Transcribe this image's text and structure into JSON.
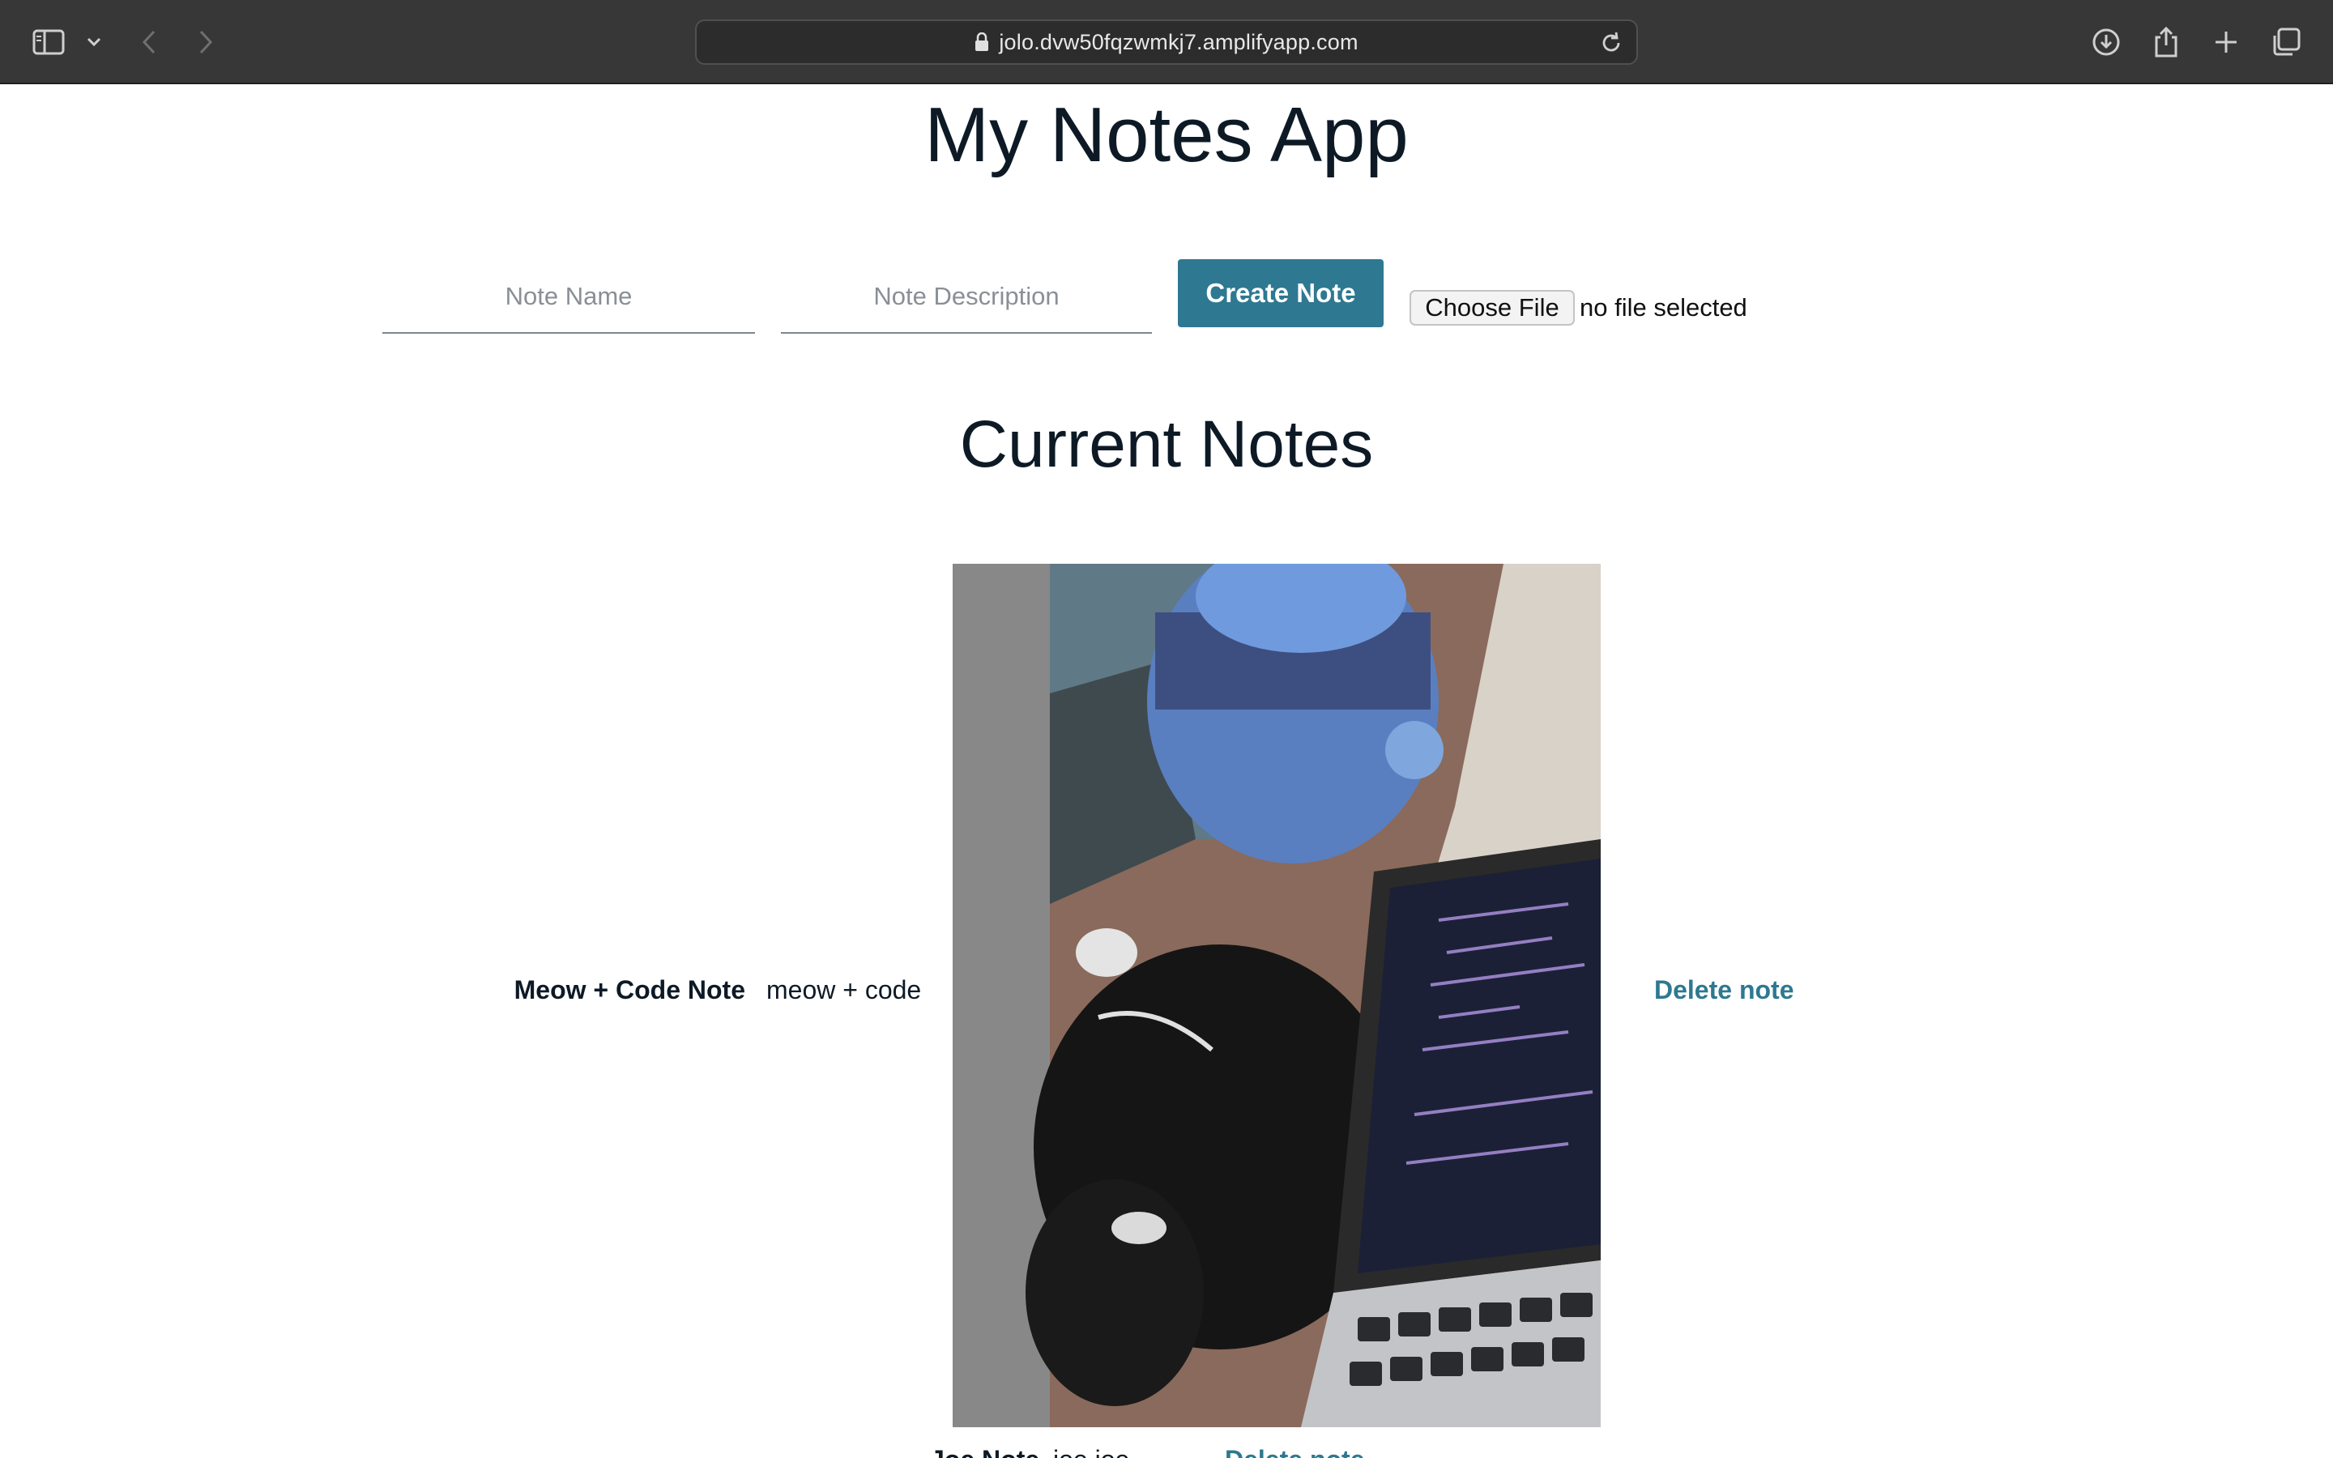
{
  "browser": {
    "url": "jolo.dvw50fqzwmkj7.amplifyapp.com"
  },
  "app": {
    "title": "My Notes App"
  },
  "form": {
    "name_placeholder": "Note Name",
    "description_placeholder": "Note Description",
    "create_label": "Create Note",
    "file_button_label": "Choose File",
    "file_status": "no file selected"
  },
  "section": {
    "title": "Current Notes"
  },
  "notes": [
    {
      "name": "Meow + Code Note",
      "description": "meow + code",
      "delete_label": "Delete note",
      "image": "cat-laptop-photo"
    },
    {
      "name": "Joe Note",
      "description": "joe joe",
      "delete_label": "Delete note"
    }
  ],
  "colors": {
    "chrome_bg": "#373737",
    "accent": "#2e7891",
    "text": "#0d1a26"
  }
}
